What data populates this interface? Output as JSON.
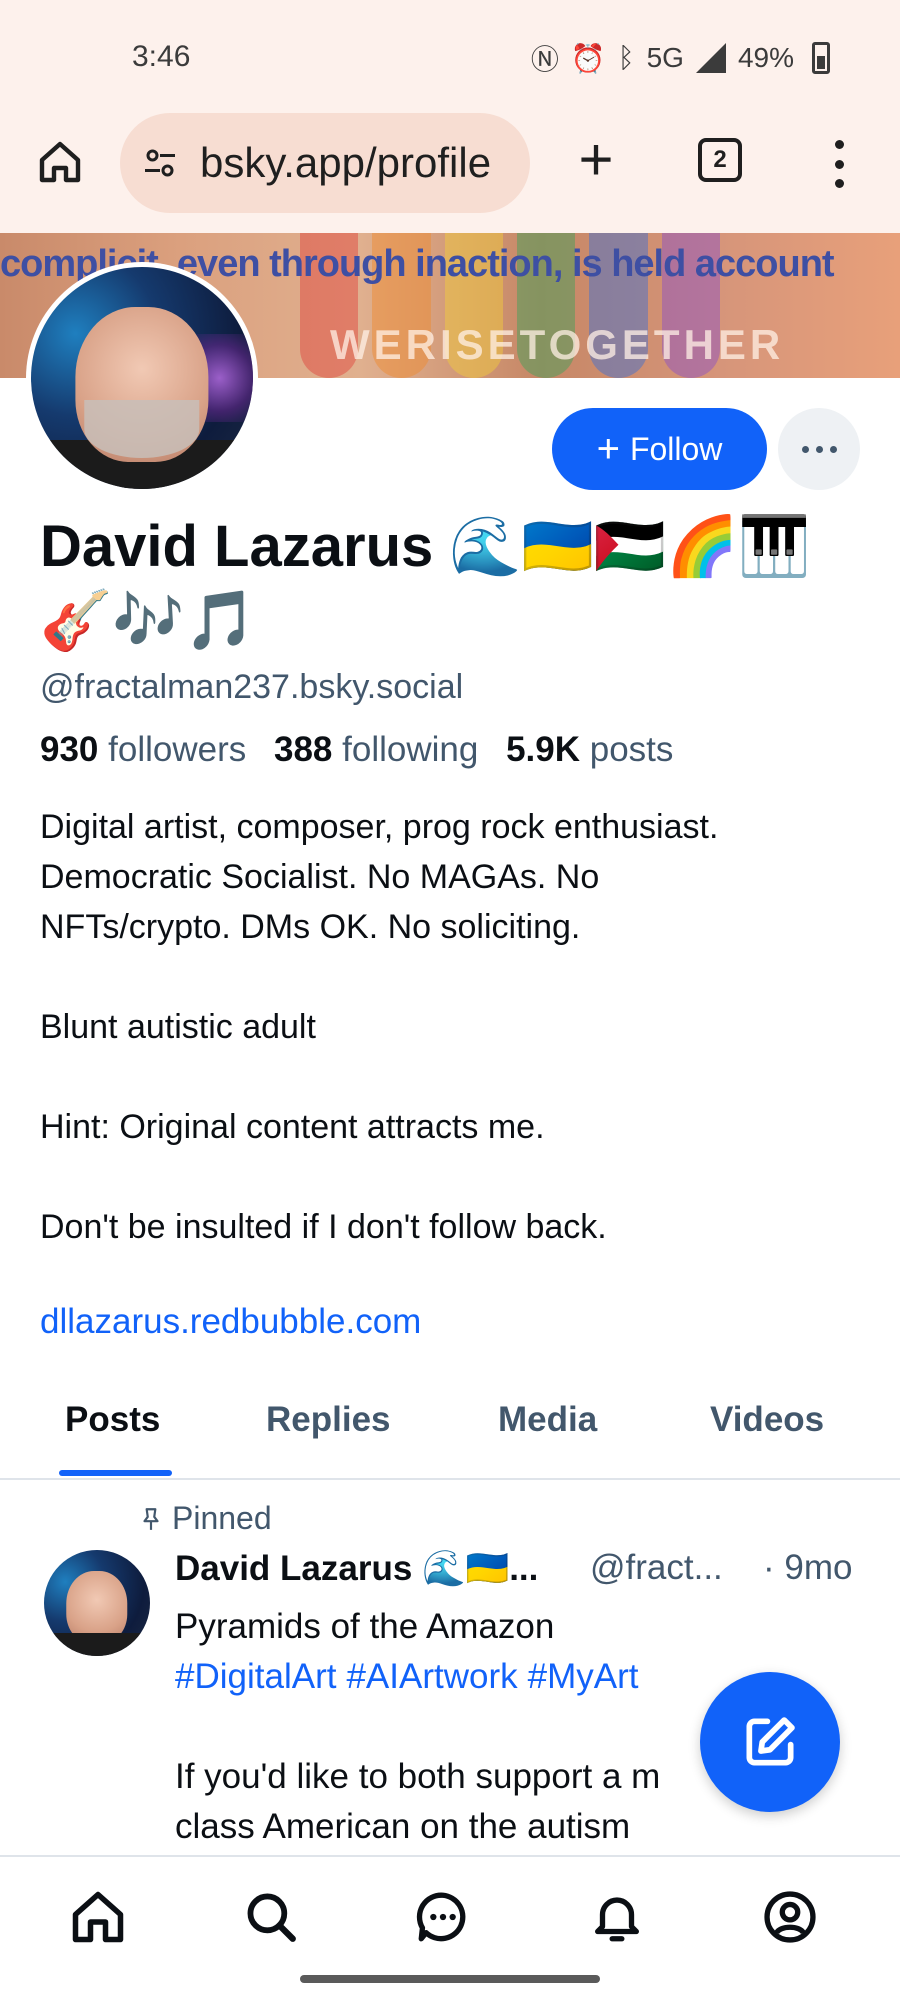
{
  "status_bar": {
    "time": "3:46",
    "network": "5G",
    "battery": "49%"
  },
  "browser": {
    "url": "bsky.app/profile",
    "tab_count": "2",
    "icons": {
      "home": "home-icon",
      "site_info": "tune-icon",
      "new_tab": "plus-icon",
      "tabs": "tab-switcher-icon",
      "menu": "more-vert-icon"
    }
  },
  "banner": {
    "top_text": "complicit, even through inaction, is held account",
    "bottom_text": "WERISETOGETHER"
  },
  "profile": {
    "display_name": "David Lazarus 🌊🇺🇦🇵🇸🌈🎹🎸🎶🎵",
    "handle": "@fractalman237.bsky.social",
    "follow_label": "Follow",
    "stats": {
      "followers_count": "930",
      "followers_label": "followers",
      "following_count": "388",
      "following_label": "following",
      "posts_count": "5.9K",
      "posts_label": "posts"
    },
    "bio_lines": [
      "Digital artist, composer, prog rock enthusiast.",
      "Democratic Socialist. No MAGAs. No",
      "NFTs/crypto. DMs OK. No soliciting.",
      "",
      "Blunt autistic adult",
      "",
      "Hint: Original content attracts me.",
      "",
      "Don't be insulted if I don't follow back."
    ],
    "link": "dllazarus.redbubble.com"
  },
  "tabs": [
    {
      "label": "Posts",
      "active": true
    },
    {
      "label": "Replies",
      "active": false
    },
    {
      "label": "Media",
      "active": false
    },
    {
      "label": "Videos",
      "active": false
    }
  ],
  "post": {
    "pinned_label": "Pinned",
    "author_name": "David Lazarus 🌊🇺🇦...",
    "author_handle": "@fract...",
    "time": "· 9mo",
    "line1": "Pyramids of the Amazon",
    "hashtags": [
      "#DigitalArt",
      "#AIArtwork",
      "#MyArt"
    ],
    "line3": "If you'd like to both support a m",
    "line4": "class American on the autism"
  },
  "colors": {
    "accent": "#1162f9",
    "muted_text": "#42576c",
    "browser_bg": "#fdf1ec"
  }
}
